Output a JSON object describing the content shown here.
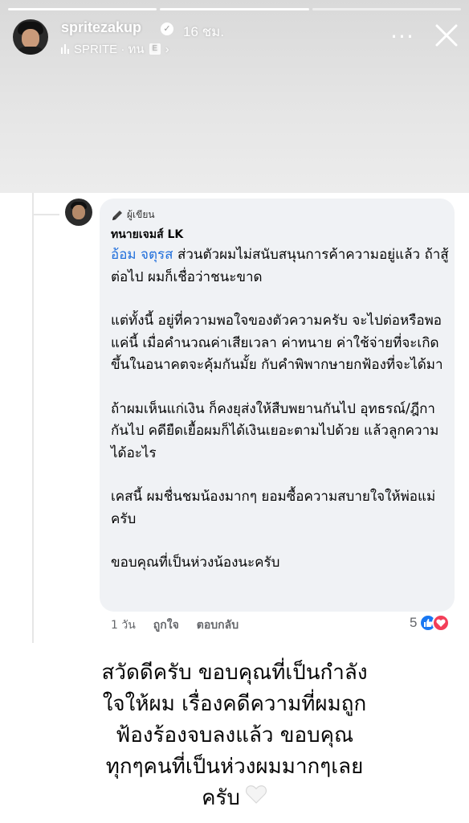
{
  "story": {
    "username": "spritezakup",
    "time_ago": "16 ชม.",
    "music": "SPRITE · ทน",
    "explicit_badge": "E",
    "more_label": "...",
    "progress_segments": 3,
    "progress_active": 2
  },
  "comment": {
    "author_badge": "ผู้เขียน",
    "author": "ทนายเจมส์ LK",
    "mention": "อ้อม จตุรส",
    "p1": " ส่วนตัวผมไม่สนับสนุนการค้าความอยู่แล้ว ถ้าสู้ต่อไป ผมก็เชื่อว่าชนะขาด",
    "p2": "แต่ทั้งนี้ อยู่ที่ความพอใจของตัวความครับ จะไปต่อหรือพอแค่นี้ เมื่อคำนวณค่าเสียเวลา ค่าทนาย ค่าใช้จ่ายที่จะเกิดขึ้นในอนาคตจะคุ้มกันมั้ย กับคำพิพากษายกฟ้องที่จะได้มา",
    "p3": "ถ้าผมเห็นแก่เงิน ก็คงยุส่งให้สืบพยานกันไป อุทธรณ์/ฎีกากันไป คดียืดเยื้อผมก็ได้เงินเยอะตามไปด้วย แล้วลูกความได้อะไร",
    "p4": "เคสนี้ ผมชื่นชมน้องมากๆ ยอมซื้อความสบายใจให้พ่อแม่ครับ",
    "p5": "ขอบคุณที่เป็นห่วงน้องนะครับ",
    "time_ago": "1 วัน",
    "like_label": "ถูกใจ",
    "reply_label": "ตอบกลับ",
    "reaction_count": "5"
  },
  "caption": {
    "line1": "สวัดดีครับ ขอบคุณที่เป็นกำลัง",
    "line2": "ใจให้ผม เรื่องคดีความที่ผมถูก",
    "line3": "ฟ้องร้องจบลงแล้ว ขอบคุณ",
    "line4": "ทุกๆคนที่เป็นห่วงผมมากๆเลย",
    "line5": "ครับ"
  },
  "colors": {
    "mention": "#216fdb",
    "bubble": "#f0f2f5",
    "like": "#1877f2",
    "love": "#f33e58"
  },
  "icons": [
    "verified-icon",
    "music-bars-icon",
    "explicit-icon",
    "more-icon",
    "close-icon",
    "pencil-icon",
    "like-icon",
    "love-icon",
    "white-heart-icon"
  ]
}
